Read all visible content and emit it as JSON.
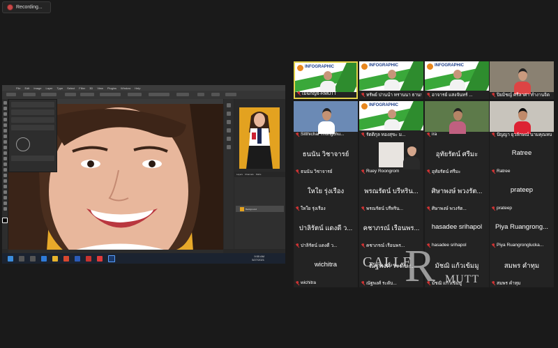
{
  "recording": {
    "label": "Recording..."
  },
  "photoshop": {
    "menu": [
      "File",
      "Edit",
      "Image",
      "Layer",
      "Type",
      "Select",
      "Filter",
      "3D",
      "View",
      "Plugins",
      "Window",
      "Help"
    ],
    "taskbar_time": "9:55 AM",
    "taskbar_date": "5/27/2021",
    "layer_name": "Background"
  },
  "gallery": {
    "tiles": [
      {
        "name": "เมฆกัญจ-RMUTT",
        "type": "banner",
        "active": true
      },
      {
        "name": "ทรัพย์ ปานนำ ทรานนา ธานนา",
        "type": "banner"
      },
      {
        "name": "อาจารย์ แสงจันทร์ ...",
        "type": "banner"
      },
      {
        "name": "ปิยมิชญ์ ศรีลาศา ทำงานจิต",
        "type": "camera"
      },
      {
        "name": "Sitthichai Thongchu...",
        "type": "camera"
      },
      {
        "name": "รัตติกุล ทองสุขะ ม...",
        "type": "banner"
      },
      {
        "name": "ira",
        "type": "camera"
      },
      {
        "name": "ปัญญา ยุวลักษณ์ นามคุณหนา",
        "type": "camera"
      },
      {
        "name": "ธนนัน วิชาจารย์",
        "type": "text",
        "big": "ธนนัน วิชาจารย์"
      },
      {
        "name": "Ruey Roongrom",
        "type": "camera"
      },
      {
        "name": "อุทัยรัตน์ ศรีมะ",
        "type": "text",
        "big": "อุทัยรัตน์ ศรีมะ"
      },
      {
        "name": "Ratree",
        "type": "text",
        "big": "Ratree"
      },
      {
        "name": "ใหใย รุ่งเรือง",
        "type": "text",
        "big": "ใหใย รุ่งเรือง"
      },
      {
        "name": "พรณรัตน์ บรีหริน...",
        "type": "text",
        "big": "พรณรัตน์ บรีหริน..."
      },
      {
        "name": "ศิษาพงษ์ พวงรัต...",
        "type": "text",
        "big": "ศิษาพงษ์ พวงรัต..."
      },
      {
        "name": "prateep",
        "type": "text",
        "big": "prateep"
      },
      {
        "name": "ปาลิรัตน์ แดงดี ว...",
        "type": "text",
        "big": "ปาลิรัตน์ แดงดี ว..."
      },
      {
        "name": "คชาภรณ์ เรือนพร...",
        "type": "text",
        "big": "คชาภรณ์ เรือนพร..."
      },
      {
        "name": "hasadee srihapol",
        "type": "text",
        "big": "hasadee srihapol"
      },
      {
        "name": "Piya Ruangronglucka...",
        "type": "text",
        "big": "Piya  Ruangrong..."
      },
      {
        "name": "wichitra",
        "type": "text",
        "big": "wichitra"
      },
      {
        "name": "ณัฐพงศ์ ระดับ...",
        "type": "text",
        "big": "ณัฐพงศ์ ระดับ..."
      },
      {
        "name": "มัชฌิ แก้วเข้มมู",
        "type": "text",
        "big": "มัชฌิ แก้วเข้มมู"
      },
      {
        "name": "สมพร คำทุม",
        "type": "text",
        "big": "สมพร คำทุม"
      }
    ]
  },
  "watermark": {
    "left": "GALLE",
    "letter": "R",
    "right": "MUTT"
  },
  "colors": {
    "accent": "#e3d24a",
    "yellow": "#e8a92a",
    "muted": "#c33"
  }
}
